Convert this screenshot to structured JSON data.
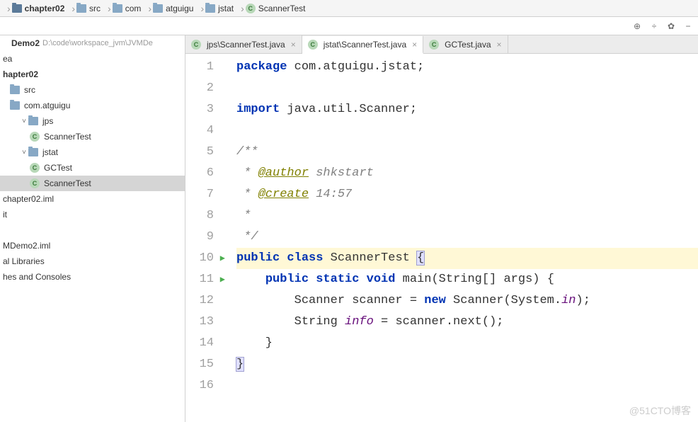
{
  "breadcrumb": [
    {
      "icon": "folder-dark",
      "text": "chapter02",
      "bold": true
    },
    {
      "icon": "folder",
      "text": "src"
    },
    {
      "icon": "folder",
      "text": "com"
    },
    {
      "icon": "folder",
      "text": "atguigu"
    },
    {
      "icon": "folder",
      "text": "jstat"
    },
    {
      "icon": "class",
      "text": "ScannerTest"
    }
  ],
  "toolbar": {
    "target": "⊕",
    "collapse": "÷",
    "settings": "✿",
    "hide": "−"
  },
  "tree": [
    {
      "indent": 1,
      "icon": "module",
      "label": "Demo2",
      "path": "D:\\code\\workspace_jvm\\JVMDe",
      "chev": ""
    },
    {
      "indent": 1,
      "icon": "",
      "label": "ea",
      "chev": ""
    },
    {
      "indent": 1,
      "icon": "",
      "label": "hapter02",
      "bold": true,
      "chev": ""
    },
    {
      "indent": 2,
      "icon": "folder",
      "label": "src",
      "chev": ""
    },
    {
      "indent": 2,
      "icon": "folder",
      "label": "com.atguigu",
      "chev": ""
    },
    {
      "indent": 3,
      "icon": "folder",
      "label": "jps",
      "chev": "v"
    },
    {
      "indent": 4,
      "icon": "class",
      "label": "ScannerTest",
      "chev": ""
    },
    {
      "indent": 3,
      "icon": "folder",
      "label": "jstat",
      "chev": "v"
    },
    {
      "indent": 4,
      "icon": "class",
      "label": "GCTest",
      "chev": ""
    },
    {
      "indent": 4,
      "icon": "class",
      "label": "ScannerTest",
      "chev": "",
      "selected": true
    },
    {
      "indent": 1,
      "icon": "file",
      "label": "chapter02.iml",
      "chev": ""
    },
    {
      "indent": 1,
      "icon": "",
      "label": "it",
      "chev": ""
    },
    {
      "indent": 1,
      "icon": "",
      "label": "",
      "chev": ""
    },
    {
      "indent": 1,
      "icon": "file",
      "label": "MDemo2.iml",
      "chev": ""
    },
    {
      "indent": 1,
      "icon": "",
      "label": "al Libraries",
      "chev": ""
    },
    {
      "indent": 1,
      "icon": "",
      "label": "hes and Consoles",
      "chev": ""
    }
  ],
  "tabs": [
    {
      "label": "jps\\ScannerTest.java",
      "active": false
    },
    {
      "label": "jstat\\ScannerTest.java",
      "active": true
    },
    {
      "label": "GCTest.java",
      "active": false
    }
  ],
  "code": {
    "lines": [
      "1",
      "2",
      "3",
      "4",
      "5",
      "6",
      "7",
      "8",
      "9",
      "10",
      "11",
      "12",
      "13",
      "14",
      "15",
      "16"
    ],
    "l1a": "package",
    "l1b": " com.atguigu.jstat;",
    "l3a": "import",
    "l3b": " java.util.Scanner;",
    "l5": "/**",
    "l6a": " * ",
    "l6b": "@author",
    "l6c": " shkstart",
    "l7a": " * ",
    "l7b": "@create",
    "l7c": " 14:57",
    "l8": " *",
    "l9": " */",
    "l10a": "public class",
    "l10b": " ScannerTest ",
    "l10c": "{",
    "l11a": "    ",
    "l11b": "public static void",
    "l11c": " main(String[] args) {",
    "l12a": "        Scanner scanner = ",
    "l12b": "new",
    "l12c": " Scanner(System.",
    "l12d": "in",
    "l12e": ");",
    "l13a": "        String ",
    "l13b": "info",
    "l13c": " = scanner.next();",
    "l14": "    }",
    "l15": "}"
  },
  "watermark": "@51CTO博客"
}
